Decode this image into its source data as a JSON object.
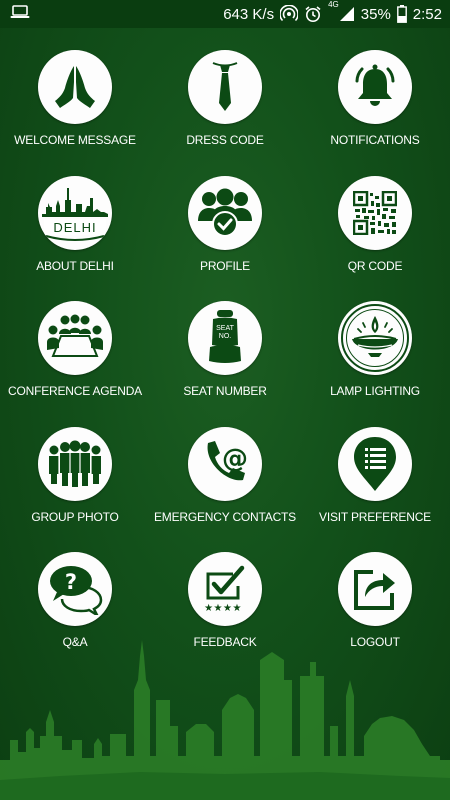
{
  "status_bar": {
    "net_speed": "643 K/s",
    "network_type": "4G",
    "battery": "35%",
    "time": "2:52",
    "icons": [
      "laptop-icon",
      "hotspot-icon",
      "alarm-icon",
      "signal-icon",
      "battery-icon"
    ]
  },
  "theme": {
    "background": "#12501a",
    "status_bar": "#0a3d10",
    "tile": "#fdfdfd",
    "icon": "#0c4a14",
    "skyline": "#2a7a26"
  },
  "menu": [
    {
      "label": "WELCOME MESSAGE",
      "icon": "namaste-icon"
    },
    {
      "label": "DRESS CODE",
      "icon": "tie-icon"
    },
    {
      "label": "NOTIFICATIONS",
      "icon": "bell-icon"
    },
    {
      "label": "ABOUT DELHI",
      "icon": "delhi-skyline-icon",
      "icon_text": "DELHI"
    },
    {
      "label": "PROFILE",
      "icon": "user-group-check-icon"
    },
    {
      "label": "QR CODE",
      "icon": "qr-code-icon"
    },
    {
      "label": "CONFERENCE AGENDA",
      "icon": "conference-table-icon"
    },
    {
      "label": "SEAT NUMBER",
      "icon": "seat-icon",
      "icon_text_1": "SEAT",
      "icon_text_2": "NO."
    },
    {
      "label": "LAMP LIGHTING",
      "icon": "diya-lamp-icon"
    },
    {
      "label": "GROUP PHOTO",
      "icon": "group-people-icon"
    },
    {
      "label": "EMERGENCY CONTACTS",
      "icon": "phone-at-icon"
    },
    {
      "label": "VISIT PREFERENCE",
      "icon": "map-pin-list-icon"
    },
    {
      "label": "Q&A",
      "icon": "speech-bubbles-question-icon"
    },
    {
      "label": "FEEDBACK",
      "icon": "checkbox-stars-icon"
    },
    {
      "label": "LOGOUT",
      "icon": "share-export-icon"
    }
  ]
}
